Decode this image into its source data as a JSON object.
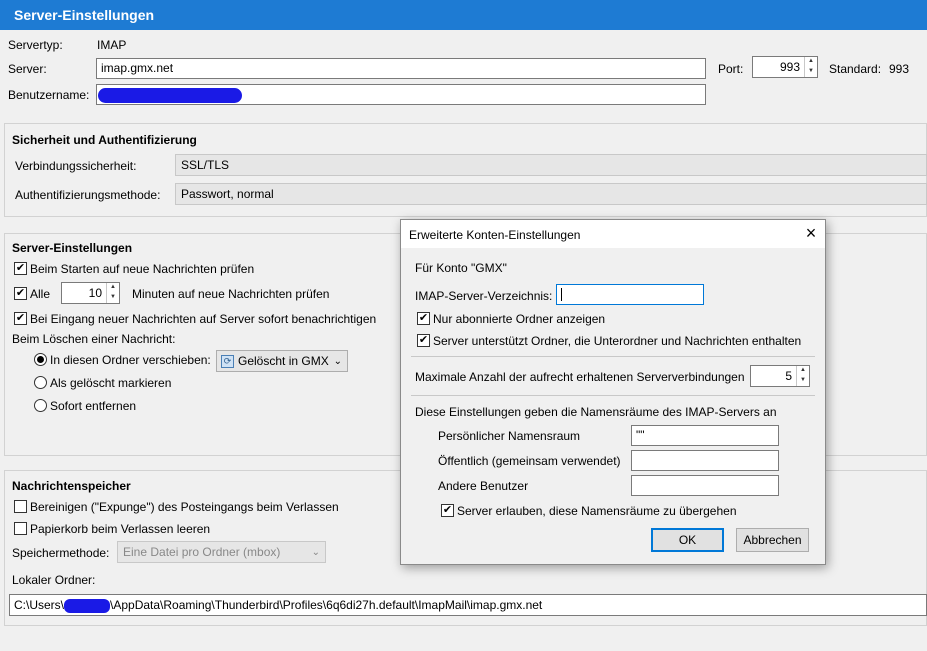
{
  "header": {
    "title": "Server-Einstellungen"
  },
  "server": {
    "type_label": "Servertyp:",
    "type_value": "IMAP",
    "server_label": "Server:",
    "server_value": "imap.gmx.net",
    "user_label": "Benutzername:",
    "port_label": "Port:",
    "port_value": "993",
    "standard_label": "Standard:",
    "standard_value": "993"
  },
  "security": {
    "title": "Sicherheit und Authentifizierung",
    "conn_label": "Verbindungssicherheit:",
    "conn_value": "SSL/TLS",
    "auth_label": "Authentifizierungsmethode:",
    "auth_value": "Passwort, normal"
  },
  "settings": {
    "title": "Server-Einstellungen",
    "check_startup": "Beim Starten auf neue Nachrichten prüfen",
    "check_every": "Alle",
    "minutes_value": "10",
    "minutes_label": "Minuten auf neue Nachrichten prüfen",
    "notify_label": "Bei Eingang neuer Nachrichten auf Server sofort benachrichtigen",
    "delete_label": "Beim Löschen einer Nachricht:",
    "move_label": "In diesen Ordner verschieben:",
    "move_folder": "Gelöscht in GMX",
    "mark_label": "Als gelöscht markieren",
    "remove_label": "Sofort entfernen"
  },
  "storage": {
    "title": "Nachrichtenspeicher",
    "expunge_label": "Bereinigen (\"Expunge\") des Posteingangs beim Verlassen",
    "trash_label": "Papierkorb beim Verlassen leeren",
    "method_label": "Speichermethode:",
    "method_value": "Eine Datei pro Ordner (mbox)",
    "local_label": "Lokaler Ordner:",
    "path_prefix": "C:\\Users\\",
    "path_middle": "\\AppData\\Roaming\\Thunderbird\\Profiles\\",
    "path_suffix": "6q6di27h.default\\ImapMail\\imap.gmx.net"
  },
  "dialog": {
    "title": "Erweiterte Konten-Einstellungen",
    "account": "Für Konto \"GMX\"",
    "dir_label": "IMAP-Server-Verzeichnis:",
    "subscribed_label": "Nur abonnierte Ordner anzeigen",
    "support_label": "Server unterstützt Ordner, die Unterordner und Nachrichten enthalten",
    "max_label": "Maximale Anzahl der aufrecht erhaltenen Serververbindungen",
    "max_value": "5",
    "ns_intro": "Diese Einstellungen geben die Namensräume des IMAP-Servers an",
    "personal_label": "Persönlicher Namensraum",
    "personal_value": "\"\"",
    "public_label": "Öffentlich (gemeinsam verwendet)",
    "others_label": "Andere Benutzer",
    "override_label": "Server erlauben, diese Namensräume zu übergehen",
    "ok_label": "OK",
    "cancel_label": "Abbrechen"
  }
}
